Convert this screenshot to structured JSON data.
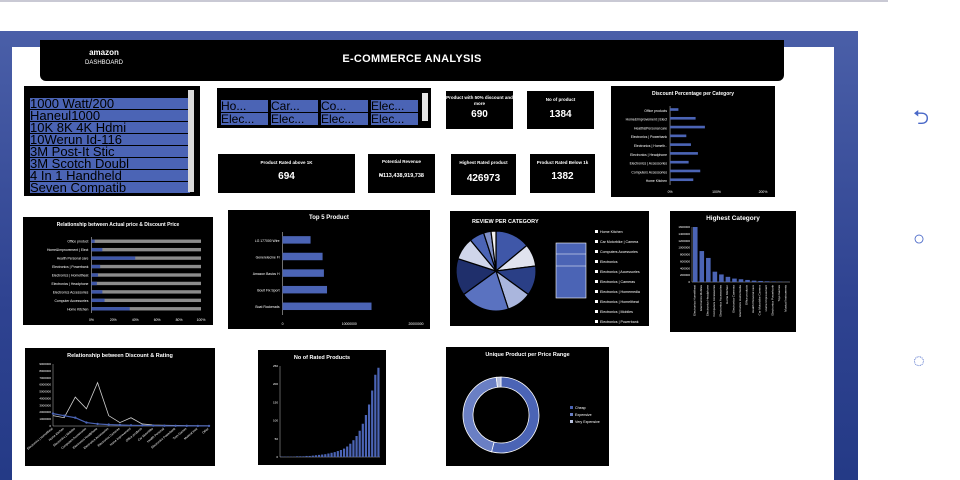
{
  "dashboard": {
    "brand": "amazon",
    "brand_sub": "DASHBOARD",
    "title": "E-COMMERCE ANALYSIS"
  },
  "slicer_products": [
    "1000 Watt/200",
    "Haneul1000",
    "10K 8K 4K Hdmi",
    "10Werun Id-116",
    "3M Post-It Stic",
    "3M Scotch Doubl",
    "4 In 1 Handheld",
    "Seven Compatib"
  ],
  "slicer_categories": [
    "Ho...",
    "Car...",
    "Co...",
    "Elec...",
    "Elec...",
    "Elec...",
    "Elec...",
    "Elec..."
  ],
  "kpis": {
    "discount50": {
      "label": "Product with 50% discount and more",
      "value": "690"
    },
    "num_products": {
      "label": "No of product",
      "value": "1384"
    },
    "rated_above_1k": {
      "label": "Product Rated above 1K",
      "value": "694"
    },
    "potential_revenue": {
      "label": "Potential Revenue",
      "value": "₦113,438,919,738"
    },
    "highest_rated": {
      "label": "Highest Rated product",
      "value": "426973"
    },
    "rated_below_1k": {
      "label": "Product Rated Below 1k",
      "value": "1382"
    }
  },
  "phone_icons": [
    "back-icon",
    "home-icon",
    "recents-icon"
  ],
  "chart_data": [
    {
      "id": "discount_pct_category",
      "type": "bar",
      "orientation": "horizontal",
      "title": "Discount Percentage per Category",
      "categories": [
        "Office products",
        "Home&Improvement | Elect",
        "Health&Personal care",
        "Electronics | Powerbank",
        "Electronics | Hometh..",
        "Electronics | Headphone",
        "Electronics | Accessories",
        "Computers Accessories",
        "Home Kitchen"
      ],
      "values": [
        18,
        55,
        75,
        35,
        45,
        60,
        40,
        65,
        50
      ],
      "xticks": [
        "0%",
        "100%",
        "200%"
      ],
      "xlim": [
        0,
        200
      ],
      "color": "#4b64b5"
    },
    {
      "id": "actual_vs_discount",
      "type": "bar",
      "orientation": "horizontal",
      "title": "Relationship between  Actual price  & Discount Price",
      "categories": [
        "Office product",
        "Home&Improvement | Elect",
        "Health Personal care",
        "Electronics | Powerbank",
        "Electronics | Homeltheat",
        "Electronics | Headphone",
        "Electronics Accessories",
        "Computer Accessories",
        "Home Kitchen"
      ],
      "series": [
        {
          "values": [
            3,
            10,
            40,
            8,
            6,
            5,
            10,
            12,
            35
          ],
          "color": "#3f57a8"
        },
        {
          "values": [
            100,
            100,
            100,
            100,
            100,
            100,
            100,
            100,
            100
          ],
          "color": "#8c8c8c"
        }
      ],
      "xticks": [
        "0%",
        "20%",
        "40%",
        "60%",
        "80%",
        "100%"
      ],
      "xlim": [
        0,
        100
      ]
    },
    {
      "id": "top5_product",
      "type": "bar",
      "orientation": "horizontal",
      "title": "Top  5 Product",
      "categories": [
        "LG 177000 Wire",
        "Generelecine Fl",
        "Amazon Basics H",
        "Boult Fix Sport",
        "Boat Rockerads"
      ],
      "values": [
        6300000,
        9000000,
        9300000,
        10000000,
        20000000
      ],
      "xticks": [
        "0",
        "10000000",
        "20000000"
      ],
      "xlim": [
        0,
        30000000
      ],
      "color": "#4b64b5"
    },
    {
      "id": "review_per_category",
      "type": "pie",
      "title": "REVIEW PER CATEGORY",
      "categories": [
        "Home Kitchen",
        "Car Motorbike | Camera",
        "Computers Accessories",
        "Electronics",
        "Electronics | Accessories",
        "Electronics | Cameras",
        "Electronics | Homemedia",
        "Electronics | Homeltheat",
        "Electronics | Mobiles",
        "Electronics | Powerbank"
      ],
      "values": [
        14,
        9,
        12,
        10,
        20,
        15,
        9,
        6,
        3,
        2
      ]
    },
    {
      "id": "highest_category",
      "type": "bar",
      "title": "Highest Category",
      "categories": [
        "Electronics Homeltheat",
        "Electronics Mobiles",
        "Electronics Headphone",
        "Computers Accessories",
        "Electronics Accessories",
        "Home Kitchen",
        "Electronics Cameras",
        "Electronics Homemedia",
        "Office products",
        "Health Personal care",
        "Car Motorbike Camera",
        "Home Improvement",
        "Electronics Powerbank",
        "Toys Games",
        "Musical Instruments"
      ],
      "values": [
        1600000,
        900000,
        700000,
        300000,
        220000,
        150000,
        100000,
        80000,
        60000,
        40000,
        30000,
        20000,
        15000,
        10000,
        5000
      ],
      "yticks": [
        "0",
        "200000",
        "400000",
        "600000",
        "800000",
        "1000000",
        "1200000",
        "1400000",
        "1600000"
      ],
      "ylim": [
        0,
        1600000
      ],
      "color": "#4b64b5"
    },
    {
      "id": "discount_vs_rating",
      "type": "line",
      "title": "Relationship between Discount & Rating",
      "categories": [
        "Electronics | Homeltheat",
        "Home Kitchen",
        "Electronics | Mobiles",
        "Computers Accessories",
        "Electronics Headphone",
        "Electronics Accessories",
        "Electronics Cameras",
        "Home Improvement",
        "Office products",
        "Car Motorbike",
        "Health Personal",
        "Electronics Powerbank",
        "Toys Games",
        "Musical Instr",
        "Other"
      ],
      "series": [
        {
          "values": [
            1500000,
            1200000,
            4200000,
            2500000,
            6300000,
            1500000,
            500000,
            1200000,
            300000,
            150000,
            100000,
            80000,
            50000,
            40000,
            30000
          ],
          "color": "#d0d0d0"
        },
        {
          "values": [
            1800000,
            1500000,
            1200000,
            500000,
            300000,
            200000,
            150000,
            100000,
            80000,
            60000,
            40000,
            30000,
            20000,
            15000,
            10000
          ],
          "color": "#4b64b5"
        }
      ],
      "yticks": [
        "0",
        "1000000",
        "2000000",
        "3000000",
        "4000000",
        "5000000",
        "6000000",
        "7000000",
        "8000000",
        "9000000"
      ],
      "ylim": [
        0,
        9000000
      ]
    },
    {
      "id": "rated_products",
      "type": "bar",
      "title": "No of Rated Products",
      "values": [
        1,
        1,
        1,
        1,
        1,
        2,
        2,
        2,
        3,
        3,
        4,
        5,
        6,
        7,
        8,
        10,
        12,
        14,
        17,
        20,
        24,
        30,
        38,
        48,
        60,
        75,
        95,
        120,
        150,
        190,
        235,
        255
      ],
      "yticks": [
        "0",
        "50",
        "100",
        "150",
        "200",
        "250"
      ],
      "ylim": [
        0,
        260
      ],
      "color": "#4b64b5"
    },
    {
      "id": "unique_product_price_range",
      "type": "pie",
      "donut": true,
      "title": "Unique Product per Price Range",
      "categories": [
        "Cheap",
        "Expensive",
        "Very Expensive"
      ],
      "values": [
        54,
        44,
        2
      ],
      "colors": [
        "#4b64b5",
        "#6a7fc4",
        "#b9c2de"
      ]
    }
  ]
}
